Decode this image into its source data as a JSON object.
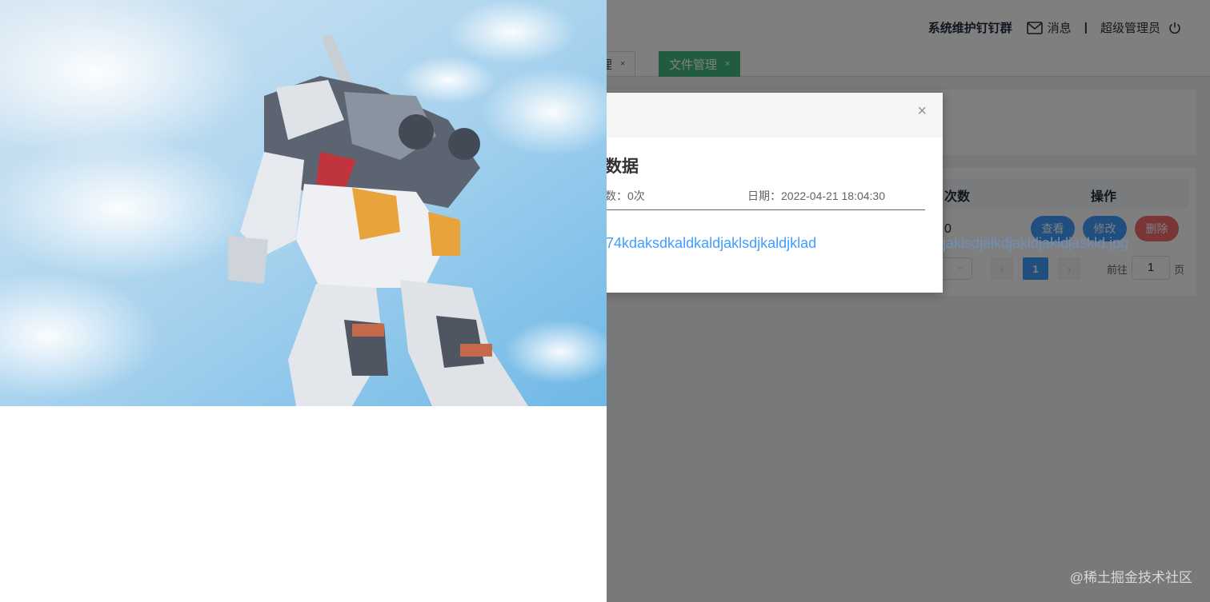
{
  "header": {
    "group_name": "系统维护钉钉群",
    "messages_label": "消息",
    "separator": "|",
    "user_name": "超级管理员",
    "icons": {
      "message": "mail-icon",
      "power": "power-icon"
    }
  },
  "tabs": [
    {
      "label": "管理",
      "close": "×",
      "active": false
    },
    {
      "label": "文件管理",
      "close": "×",
      "active": true
    }
  ],
  "table": {
    "headers": {
      "count": "次数",
      "operation": "操作"
    },
    "row": {
      "count": "0"
    },
    "actions": {
      "view": "查看",
      "edit": "修改",
      "delete": "删除"
    }
  },
  "pagination": {
    "prev": "‹",
    "current_page": "1",
    "next": "›",
    "goto_label": "前往",
    "goto_value": "1",
    "page_suffix": "页"
  },
  "dialog": {
    "close": "×",
    "title": "数据",
    "meta_left": "数：0次",
    "meta_right": "日期：2022-04-21 18:04:30",
    "link_visible": "74kdaksdkaldkaldjaklsdjkaldjklad",
    "link_overflow": "jaklsdjalkdjakldjakldjaskld.jpg"
  },
  "preview": {
    "image_subject": "giant robot statue against blue sky with clouds"
  },
  "watermark": "@稀土掘金技术社区",
  "colors": {
    "primary": "#409eff",
    "danger": "#f56c6c",
    "active_tab": "#42b983",
    "mask": "rgba(0,0,0,0.5)"
  }
}
